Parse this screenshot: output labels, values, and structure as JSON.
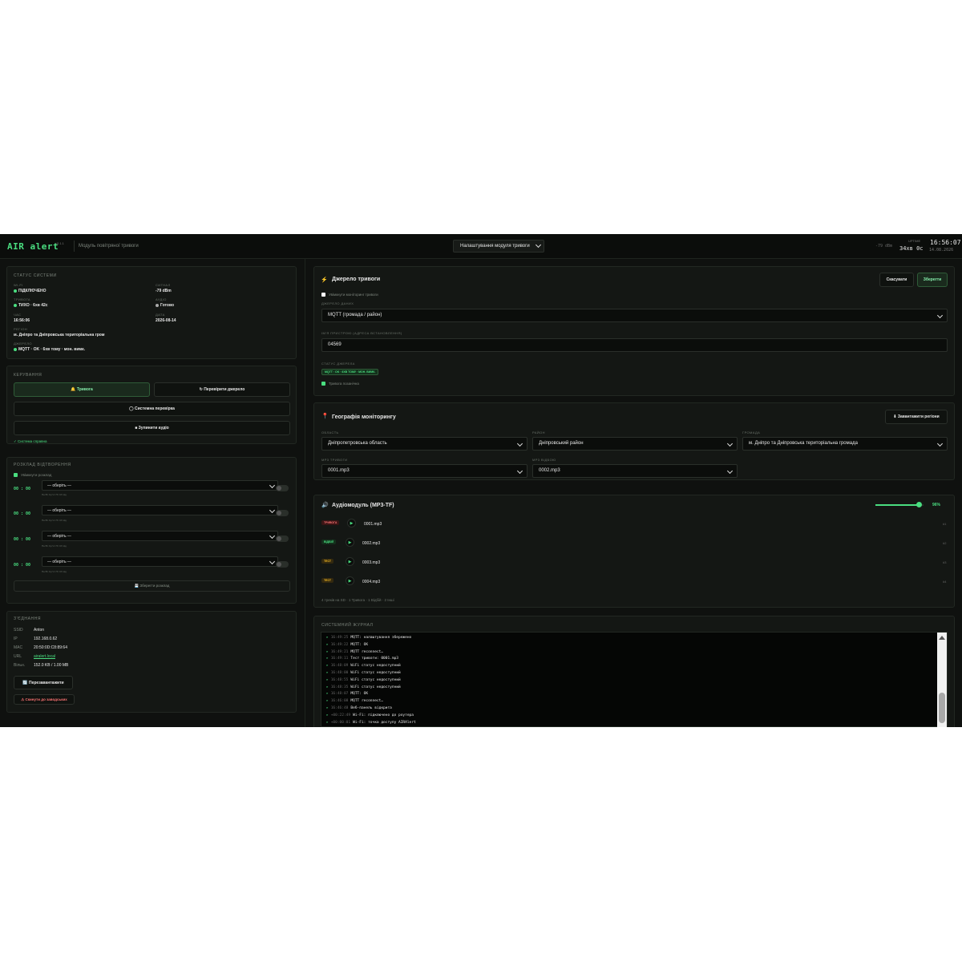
{
  "header": {
    "logo": "AIR alert",
    "version": "v0.1.1",
    "subtitle": "Модуль повітряної тривоги",
    "module_select": "Налаштування модуля тривоги",
    "wifi_signal": "-79 dBm",
    "uptime_label": "UPTIME",
    "uptime": "34хв 0с",
    "clock": "16:56:07",
    "date": "14.08.2026"
  },
  "status": {
    "title": "Статус системи",
    "wifi_label": "WI-FI",
    "wifi_value": "ПІДКЛЮЧЕНО",
    "signal_label": "СИГНАЛ",
    "signal_value": "-79 dBm",
    "alarm_label": "ТРИВОГА",
    "alarm_value": "ТИХО · 6хв 42с",
    "audio_label": "АУДІО",
    "audio_value": "Готово",
    "time_label": "ЧАС",
    "time_value": "16:56:06",
    "date_label": "ДАТА",
    "date_value": "2026-08-14",
    "region_label": "РЕГІОН",
    "region_value": "м. Дніпро та Дніпровська територіальна гром",
    "source_label": "ДЖЕРЕЛО",
    "source_value": "MQTT · OK · 6хв тому · мон. вимк."
  },
  "control": {
    "title": "Керування",
    "alarm_btn": "🔔 Тривога",
    "check_source_btn": "↻ Перевірити джерело",
    "system_check_btn": "◯ Системна перевірка",
    "stop_audio_btn": "■ Зупинити аудіо",
    "status_text": "✓ Система справна"
  },
  "schedule": {
    "title": "Розклад відтворення",
    "enable_label": "Увімкнути розклад",
    "rows": [
      {
        "time": "00 : 00",
        "select": "— оберіть —",
        "days": "Пн Вт Ср Чт Пт Сб Нд"
      },
      {
        "time": "00 : 00",
        "select": "— оберіть —",
        "days": "Пн Вт Ср Чт Пт Сб Нд"
      },
      {
        "time": "00 : 00",
        "select": "— оберіть —",
        "days": "Пн Вт Ср Чт Пт Сб Нд"
      },
      {
        "time": "00 : 00",
        "select": "— оберіть —",
        "days": "Пн Вт Ср Чт Пт Сб Нд"
      }
    ],
    "save_btn": "💾 Зберегти розклад"
  },
  "connection": {
    "title": "З'єднання",
    "ssid_label": "SSID",
    "ssid_value": "Anton",
    "ip_label": "IP",
    "ip_value": "192.168.0.62",
    "mac_label": "MAC",
    "mac_value": "20:50:0D:C8:89:64",
    "url_label": "URL",
    "url_value": "airalert.local",
    "heap_label": "Вільн.",
    "heap_value": "152.0 KB / 1.00 MB",
    "reboot_btn": "🔄 Перезавантажити",
    "reset_btn": "⚠ Скинути до заводських"
  },
  "source": {
    "title": "Джерело тривоги",
    "cancel_btn": "Скасувати",
    "save_btn": "Зберегти",
    "monitor_label": "Увімкнути моніторинг тривоги",
    "data_source_label": "ДЖЕРЕЛО ДАНИХ",
    "data_source_value": "MQTT (громада / район)",
    "device_id_label": "ІМ'Я ПРИСТРОЮ (АДРЕСА ВСТАНОВЛЕННЯ)",
    "device_id_value": "04569",
    "source_status_label": "СТАТУС ДЖЕРЕЛА",
    "source_status_value": "MQTT · OK · 6хв тому · мон. вимк.",
    "alarm_unconfirmed_label": "Тривога позанічна"
  },
  "geo": {
    "title": "Географія моніторингу",
    "load_btn": "⬇ Завантажити регіони",
    "oblast_label": "ОБЛАСТЬ",
    "oblast_value": "Дніпропетровська область",
    "raion_label": "РАЙОН",
    "raion_value": "Дніпровський район",
    "hromada_label": "ГРОМАДА",
    "hromada_value": "м. Дніпро та Дніпровська територіальна громада",
    "mp3_alarm_label": "MP3 ТРИВОГИ",
    "mp3_alarm_value": "0001.mp3",
    "mp3_cancel_label": "MP3 ВІДБОЮ",
    "mp3_cancel_value": "0002.mp3"
  },
  "audio": {
    "title": "Аудіомодуль (MP3-TF)",
    "volume": "96%",
    "volume_level": 0.9,
    "tracks": [
      {
        "tag": "ТРИВОГА",
        "name": "0001.mp3",
        "num": "#1",
        "color": "#f87171",
        "bg": "#3a1515"
      },
      {
        "tag": "ВІДБІЙ",
        "name": "0002.mp3",
        "num": "#2",
        "color": "#4ade80",
        "bg": "#14301c"
      },
      {
        "tag": "ТЕСТ",
        "name": "0003.mp3",
        "num": "#3",
        "color": "#fbbf24",
        "bg": "#33290f"
      },
      {
        "tag": "ТЕСТ",
        "name": "0004.mp3",
        "num": "#4",
        "color": "#fbbf24",
        "bg": "#33290f"
      }
    ],
    "summary": "4 треків на SD · 1 Тривога · 1 Відбій · 2 Інші"
  },
  "log": {
    "title": "Системний журнал",
    "lines": [
      {
        "t": "16:49:25",
        "m": "MQTT: налаштування збережено"
      },
      {
        "t": "16:49:22",
        "m": "MQTT: OK"
      },
      {
        "t": "16:49:21",
        "m": "MQTT reconnect…"
      },
      {
        "t": "16:49:11",
        "m": "Тест тривоги: 0001.mp3"
      },
      {
        "t": "16:48:09",
        "m": "WiFi статус недоступний"
      },
      {
        "t": "16:48:00",
        "m": "WiFi статус недоступний"
      },
      {
        "t": "16:48:55",
        "m": "WiFi статус недоступний"
      },
      {
        "t": "16:48:35",
        "m": "WiFi статус недоступний"
      },
      {
        "t": "16:48:07",
        "m": "MQTT: OK"
      },
      {
        "t": "16:46:08",
        "m": "MQTT reconnect…"
      },
      {
        "t": "16:46:48",
        "m": "Веб-панель відкрита"
      },
      {
        "t": "+00:22:49",
        "m": "Wi-Fi: підключено до роутера"
      },
      {
        "t": "+00:00:01",
        "m": "Wi-Fi: точка доступу AIRAlert"
      }
    ]
  },
  "colors": {
    "accent": "#4ade80",
    "background": "#0f110f",
    "danger": "#f87171"
  }
}
